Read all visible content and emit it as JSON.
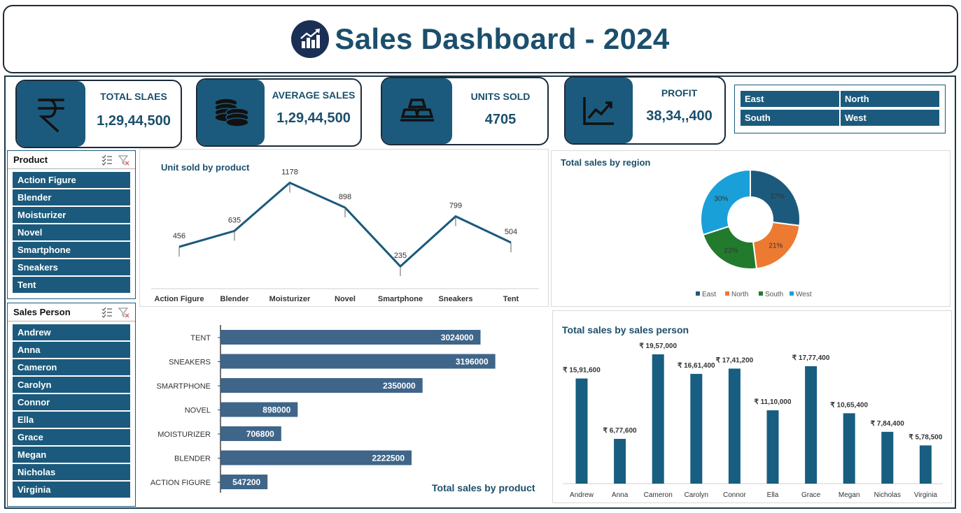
{
  "header": {
    "title": "Sales Dashboard - 2024"
  },
  "kpis": {
    "total_sales": {
      "label": "TOTAL SLAES",
      "value": "1,29,44,500",
      "icon": "rupee-icon"
    },
    "average_sales": {
      "label": "AVERAGE SALES",
      "value": "1,29,44,500",
      "icon": "coins-icon"
    },
    "units_sold": {
      "label": "UNITS SOLD",
      "value": "4705",
      "icon": "gold-bars-icon"
    },
    "profit": {
      "label": "PROFIT",
      "value": "38,34,,400",
      "icon": "chart-growth-icon"
    }
  },
  "region_slicer": {
    "items": [
      "East",
      "North",
      "South",
      "West"
    ]
  },
  "product_slicer": {
    "title": "Product",
    "items": [
      "Action Figure",
      "Blender",
      "Moisturizer",
      "Novel",
      "Smartphone",
      "Sneakers",
      "Tent"
    ]
  },
  "salesperson_slicer": {
    "title": "Sales Person",
    "items": [
      "Andrew",
      "Anna",
      "Cameron",
      "Carolyn",
      "Connor",
      "Ella",
      "Grace",
      "Megan",
      "Nicholas",
      "Virginia"
    ]
  },
  "colors": {
    "accent": "#1b5a7c",
    "title": "#1b4f6b",
    "bar_dark": "#175e81",
    "bar_slate": "#3f6589",
    "east": "#1b5a7c",
    "north": "#ec7a30",
    "south": "#227a2c",
    "west": "#1aa0d9"
  },
  "chart_data": [
    {
      "type": "line",
      "title": "Unit sold by product",
      "categories": [
        "Action Figure",
        "Blender",
        "Moisturizer",
        "Novel",
        "Smartphone",
        "Sneakers",
        "Tent"
      ],
      "values": [
        456,
        635,
        1178,
        898,
        235,
        799,
        504
      ],
      "ylim": [
        0,
        1300
      ]
    },
    {
      "type": "pie",
      "title": "Total sales by region",
      "categories": [
        "East",
        "North",
        "South",
        "West"
      ],
      "values": [
        27,
        21,
        22,
        30
      ],
      "labels": [
        "27%",
        "21%",
        "22%",
        "30%"
      ]
    },
    {
      "type": "bar",
      "orientation": "horizontal",
      "title": "Total sales by product",
      "categories": [
        "TENT",
        "SNEAKERS",
        "SMARTPHONE",
        "NOVEL",
        "MOISTURIZER",
        "BLENDER",
        "ACTION FIGURE"
      ],
      "values": [
        3024000,
        3196000,
        2350000,
        898000,
        706800,
        2222500,
        547200
      ],
      "xlim": [
        0,
        3500000
      ]
    },
    {
      "type": "bar",
      "title": "Total sales by sales person",
      "categories": [
        "Andrew",
        "Anna",
        "Cameron",
        "Carolyn",
        "Connor",
        "Ella",
        "Grace",
        "Megan",
        "Nicholas",
        "Virginia"
      ],
      "values": [
        1591600,
        677600,
        1957000,
        1661400,
        1741200,
        1110000,
        1777400,
        1065400,
        784400,
        578500
      ],
      "labels": [
        "₹ 15,91,600",
        "₹ 6,77,600",
        "₹ 19,57,000",
        "₹ 16,61,400",
        "₹ 17,41,200",
        "₹ 11,10,000",
        "₹ 17,77,400",
        "₹ 10,65,400",
        "₹ 7,84,400",
        "₹ 5,78,500"
      ],
      "ylim": [
        0,
        2000000
      ]
    }
  ]
}
